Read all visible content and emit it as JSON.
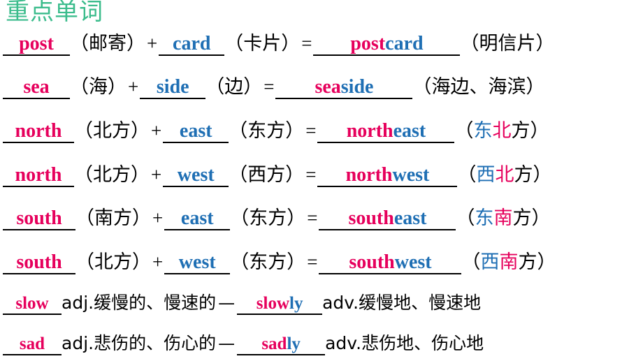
{
  "slide": {
    "title": "重点单词",
    "title_color": "#3BBC8C",
    "colors": {
      "pink": "#E6005C",
      "blue": "#1F6FB4",
      "black": "#000000",
      "green": "#3BBC8C"
    }
  },
  "rows": [
    {
      "id": "postcard",
      "word1": "post",
      "word1_gloss": "（邮寄）",
      "plus": "+",
      "word2": "card",
      "word2_gloss": "（卡片）",
      "equals": "=",
      "result_a": "post",
      "result_b": "card",
      "result_gloss": "（明信片）"
    },
    {
      "id": "seaside",
      "word1": "sea",
      "word1_gloss": "（海）",
      "plus": "+",
      "word2": "side",
      "word2_gloss": "（边）",
      "equals": "=",
      "result_a": "sea",
      "result_b": "side",
      "result_gloss": "（海边、海滨）"
    },
    {
      "id": "northeast",
      "word1": "north",
      "word1_gloss": "（北方）",
      "plus": "+",
      "word2": "east",
      "word2_gloss": "（东方）",
      "equals": "=",
      "result_a": "north",
      "result_b": "east",
      "result_gloss_open": "（",
      "result_gloss_c1": "东",
      "result_gloss_c2": "北",
      "result_gloss_c3": "方",
      "result_gloss_close": "）"
    },
    {
      "id": "northwest",
      "word1": "north",
      "word1_gloss": "（北方）",
      "plus": "+",
      "word2": "west",
      "word2_gloss": "（西方）",
      "equals": "=",
      "result_a": "north",
      "result_b": "west",
      "result_gloss_open": "（",
      "result_gloss_c1": "西",
      "result_gloss_c2": "北",
      "result_gloss_c3": "方",
      "result_gloss_close": "）"
    },
    {
      "id": "southeast",
      "word1": "south",
      "word1_gloss": "（南方）",
      "plus": "+",
      "word2": "east",
      "word2_gloss": "（东方）",
      "equals": "=",
      "result_a": "south",
      "result_b": "east",
      "result_gloss_open": "（",
      "result_gloss_c1": "东",
      "result_gloss_c2": "南",
      "result_gloss_c3": "方",
      "result_gloss_close": "）"
    },
    {
      "id": "southwest",
      "word1": "south",
      "word1_gloss": "（北方）",
      "plus": "+",
      "word2": "west",
      "word2_gloss": "（东方）",
      "equals": "=",
      "result_a": "south",
      "result_b": "west",
      "result_gloss_open": "（",
      "result_gloss_c1": "西",
      "result_gloss_c2": "南",
      "result_gloss_c3": "方",
      "result_gloss_close": "）"
    }
  ],
  "adv_rows": [
    {
      "id": "slowly",
      "word1": "slow",
      "word1_pos": "adj.",
      "word1_gloss": "缓慢的、慢速的",
      "dash": "—",
      "result_a": "slow",
      "result_b": "ly",
      "result_pos": "adv.",
      "result_gloss": " 缓慢地、慢速地"
    },
    {
      "id": "sadly",
      "word1": "sad",
      "word1_pos": "adj.",
      "word1_gloss": "悲伤的、伤心的",
      "dash": "—",
      "result_a": "sad",
      "result_b": "ly",
      "result_pos": "adv.",
      "result_gloss": "悲伤地、伤心地"
    }
  ]
}
